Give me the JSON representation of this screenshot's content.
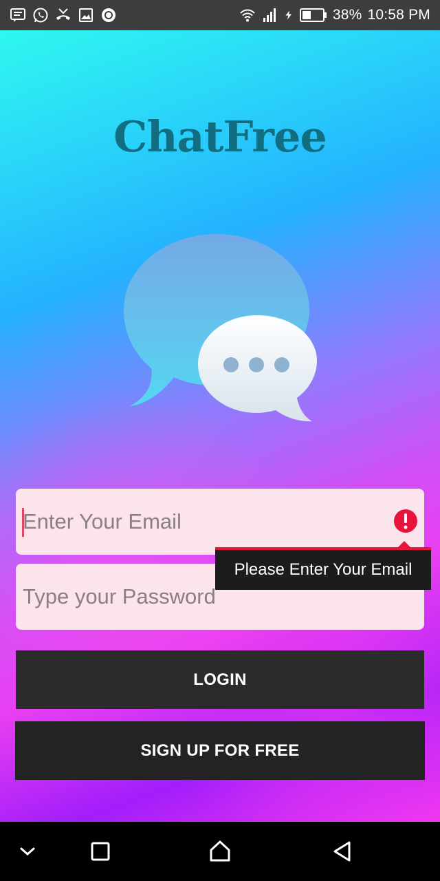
{
  "status_bar": {
    "left_icons": [
      "message-icon",
      "whatsapp-icon",
      "missed-call-icon",
      "image-icon",
      "record-icon"
    ],
    "right_icons": [
      "wifi-icon",
      "signal-icon",
      "charging-icon",
      "battery-icon"
    ],
    "battery_percent": "38%",
    "time": "10:58 PM"
  },
  "app": {
    "title": "ChatFree",
    "title_color": "#136d80",
    "illustration": "chat-bubbles-icon",
    "email_field": {
      "value": "",
      "placeholder": "Enter Your Email",
      "has_error": true,
      "error_message": "Please Enter Your Email"
    },
    "password_field": {
      "value": "",
      "placeholder": "Type your Password"
    },
    "login_button": "LOGIN",
    "signup_button": "SIGN UP FOR FREE",
    "colors": {
      "field_background": "#fce4ec",
      "button_background": "#2b2b2c",
      "error_accent": "#e8143c"
    }
  },
  "nav_bar": {
    "buttons": [
      "hide-keyboard-icon",
      "recents-icon",
      "home-icon",
      "back-icon"
    ]
  }
}
